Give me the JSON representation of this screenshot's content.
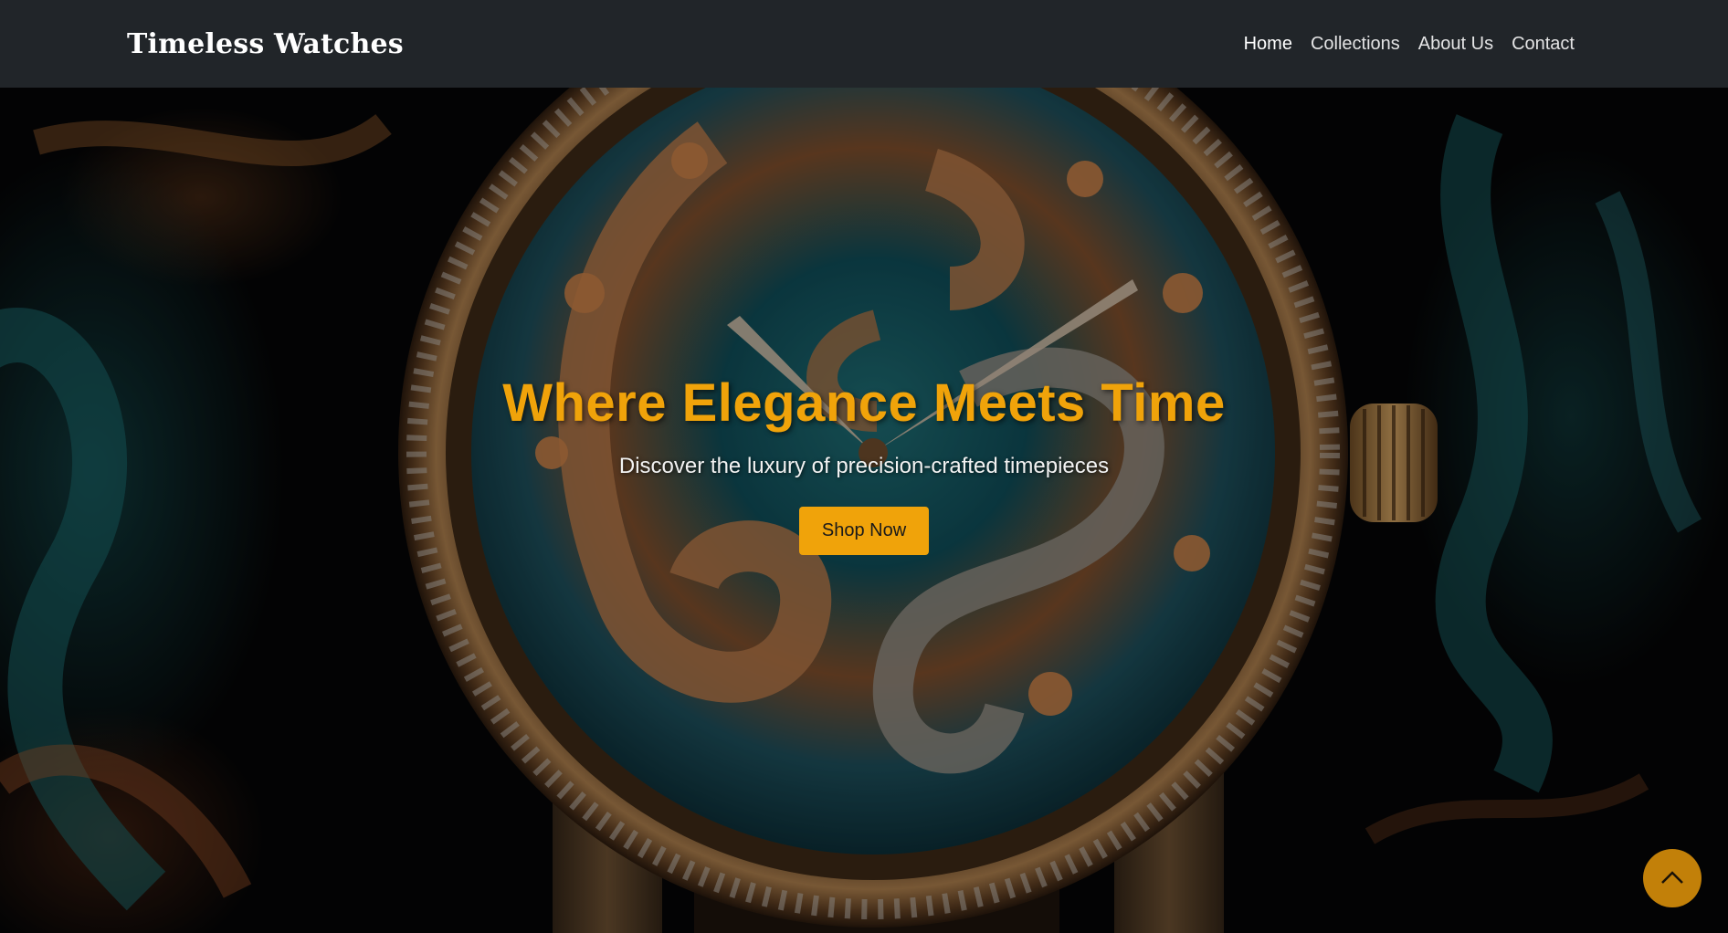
{
  "navbar": {
    "brand": "Timeless Watches",
    "links": [
      {
        "label": "Home",
        "active": true
      },
      {
        "label": "Collections",
        "active": false
      },
      {
        "label": "About Us",
        "active": false
      },
      {
        "label": "Contact",
        "active": false
      }
    ]
  },
  "hero": {
    "title": "Where Elegance Meets Time",
    "subtitle": "Discover the luxury of precision-crafted timepieces",
    "cta_label": "Shop Now",
    "background": "ornate-jeweled-watch-image"
  },
  "scroll_top": {
    "icon": "chevron-up-icon"
  },
  "colors": {
    "navbar_bg": "#212529",
    "accent": "#f0a30a",
    "scroll_button": "#c28009",
    "text_light": "#ffffff"
  }
}
